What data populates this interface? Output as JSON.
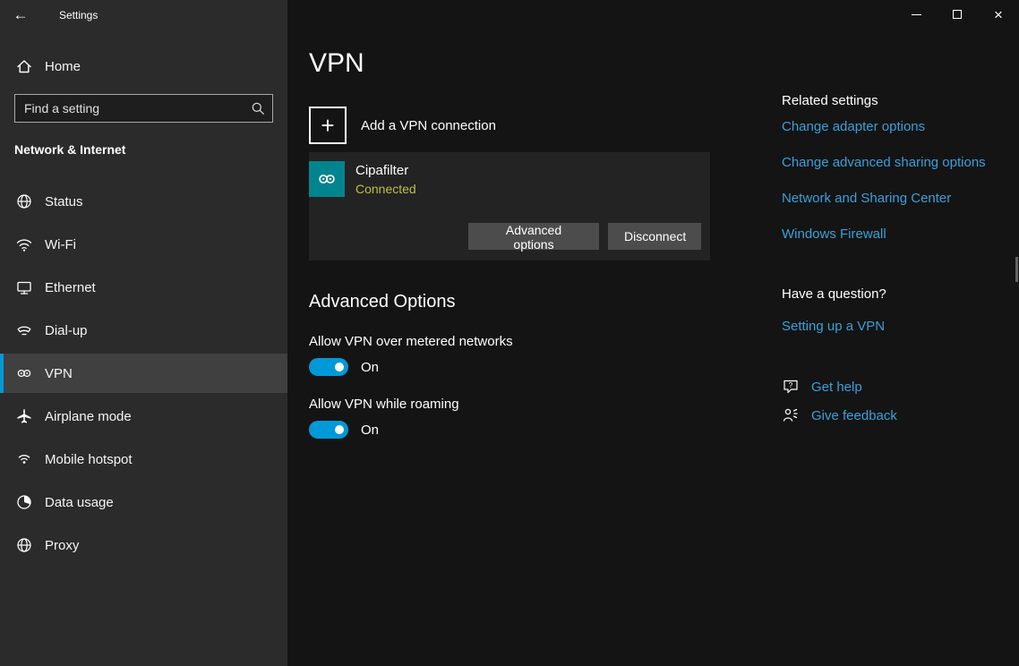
{
  "window": {
    "title": "Settings"
  },
  "icons": {
    "back": "←",
    "plus": "+",
    "close": "×",
    "minimize": "minimize-bar",
    "maximize": "maximize-box",
    "search": "magnifier",
    "home": "house",
    "status": "globe",
    "wifi": "wifi-arcs",
    "ethernet": "monitor",
    "dialup": "telephone-handset",
    "vpn": "linked-rings",
    "airplane": "airplane",
    "hotspot": "broadcast-dot",
    "data_usage": "pie-chart",
    "proxy": "globe",
    "vpn_connection": "linked-rings-on-teal-tile",
    "get_help": "chat-bubble-question",
    "give_feedback": "person-announcing"
  },
  "sidebar": {
    "home_label": "Home",
    "search_placeholder": "Find a setting",
    "section_title": "Network & Internet",
    "items": [
      {
        "label": "Status",
        "icon": "status-icon",
        "selected": false
      },
      {
        "label": "Wi-Fi",
        "icon": "wifi-icon",
        "selected": false
      },
      {
        "label": "Ethernet",
        "icon": "ethernet-icon",
        "selected": false
      },
      {
        "label": "Dial-up",
        "icon": "dialup-icon",
        "selected": false
      },
      {
        "label": "VPN",
        "icon": "vpn-icon",
        "selected": true
      },
      {
        "label": "Airplane mode",
        "icon": "airplane-icon",
        "selected": false
      },
      {
        "label": "Mobile hotspot",
        "icon": "hotspot-icon",
        "selected": false
      },
      {
        "label": "Data usage",
        "icon": "data-usage-icon",
        "selected": false
      },
      {
        "label": "Proxy",
        "icon": "proxy-icon",
        "selected": false
      }
    ]
  },
  "main": {
    "title": "VPN",
    "add_button_label": "Add a VPN connection",
    "connection": {
      "name": "Cipafilter",
      "status": "Connected",
      "advanced_label": "Advanced options",
      "disconnect_label": "Disconnect"
    },
    "advanced_heading": "Advanced Options",
    "toggles": [
      {
        "label": "Allow VPN over metered networks",
        "state": "On"
      },
      {
        "label": "Allow VPN while roaming",
        "state": "On"
      }
    ]
  },
  "related": {
    "heading": "Related settings",
    "links": [
      "Change adapter options",
      "Change advanced sharing options",
      "Network and Sharing Center",
      "Windows Firewall"
    ]
  },
  "question": {
    "heading": "Have a question?",
    "link": "Setting up a VPN"
  },
  "help": {
    "get_help": "Get help",
    "give_feedback": "Give feedback"
  },
  "colors": {
    "accent": "#0099d8",
    "link": "#3c9fd9",
    "connected_status": "#bdbf4a",
    "vpn_tile": "#00848e",
    "sidebar_bg": "#2b2b2b",
    "main_bg": "#141414",
    "card_bg": "#232323",
    "button_bg": "#4c4c4c"
  }
}
